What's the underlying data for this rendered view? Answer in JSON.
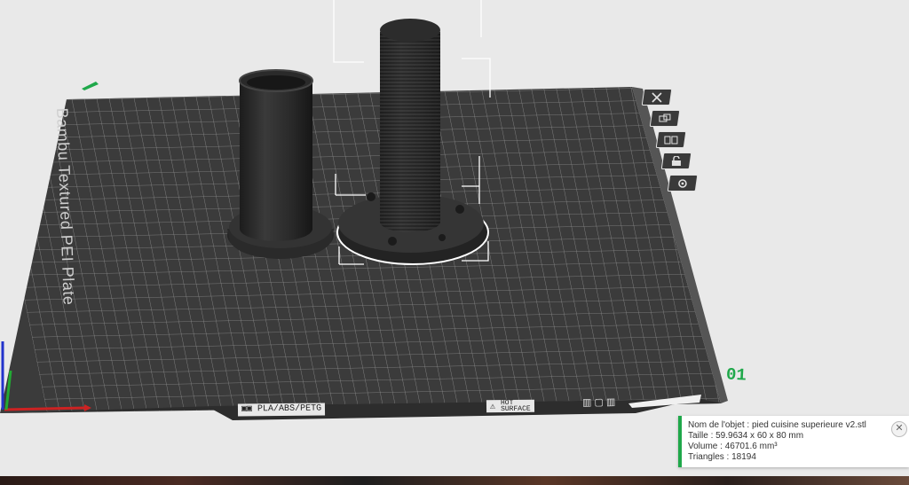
{
  "plate": {
    "name": "Bambu Textured PEI Plate",
    "number": "01",
    "materials": "PLA/ABS/PETG",
    "surface_line1": "HOT",
    "surface_line2": "SURFACE"
  },
  "toolbar": {
    "icons": [
      "close-icon",
      "orient-icon",
      "arrange-icon",
      "lock-icon",
      "settings-icon"
    ]
  },
  "object_info": {
    "name": "Nom de l'objet : pied cuisine superieure v2.stl",
    "size": "Taille : 59.9634 x 60 x 80 mm",
    "volume": "Volume : 46701.6 mm³",
    "triangles": "Triangles : 18194",
    "close_label": "✕"
  },
  "colors": {
    "plate": "#3b3b3b",
    "grid": "#8e8e8e",
    "accent": "#1fa84a",
    "object": "#2e2e2e",
    "background": "#e9e9e9"
  }
}
